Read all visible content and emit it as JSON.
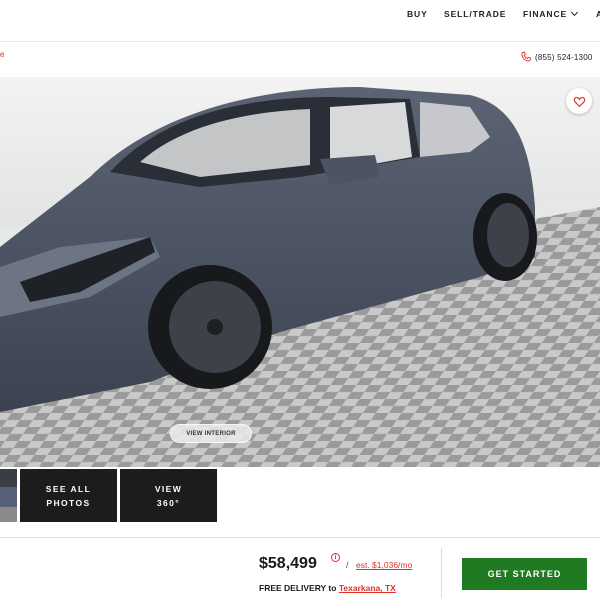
{
  "nav": {
    "items": [
      "BUY",
      "SELL/TRADE",
      "FINANCE",
      "A"
    ]
  },
  "subbar": {
    "left_mark": "e",
    "phone": "(855) 524-1300"
  },
  "gallery": {
    "view_interior_label": "VIEW INTERIOR",
    "see_all_line1": "SEE ALL",
    "see_all_line2": "PHOTOS",
    "view360_line1": "VIEW",
    "view360_line2": "360°",
    "favorite_icon": "heart-icon"
  },
  "pricing": {
    "price": "$58,499",
    "info_icon": "i",
    "slash": "/",
    "monthly": "est. $1,036/mo",
    "delivery_prefix": "FREE DELIVERY to ",
    "delivery_location": "Texarkana, TX",
    "cta_label": "GET STARTED"
  },
  "colors": {
    "accent_red": "#e0312b",
    "cta_green": "#1f7a21",
    "thumb_dark": "#1c1c1c"
  }
}
